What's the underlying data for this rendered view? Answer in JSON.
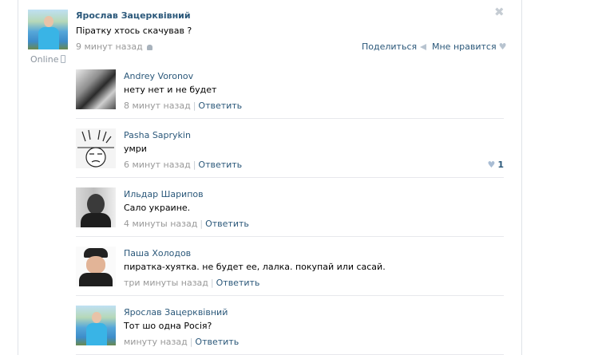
{
  "post": {
    "author": "Ярослав Зацерквівний",
    "text": "Піратку хтось скачував ?",
    "time": "9 минут назад",
    "presence": "Online",
    "share_label": "Поделиться",
    "like_label": "Мне нравится",
    "close": "✖"
  },
  "comments": [
    {
      "author": "Andrey Voronov",
      "text": "нету нет и не будет",
      "time": "8 минут назад",
      "reply": "Ответить",
      "sep": "|"
    },
    {
      "author": "Pasha Saprykin",
      "text": "умри",
      "time": "6 минут назад",
      "reply": "Ответить",
      "sep": "|",
      "likes": "1"
    },
    {
      "author": "Ильдар Шарипов",
      "text": "Сало украине.",
      "time": "4 минуты назад",
      "reply": "Ответить",
      "sep": "|"
    },
    {
      "author": "Паша Холодов",
      "text": "пиратка-хуятка. не будет ее, лалка. покупай или сасай.",
      "time": "три минуты назад",
      "reply": "Ответить",
      "sep": "|"
    },
    {
      "author": "Ярослав Зацерквівний",
      "text": "Тот шо одна Росія?",
      "time": "минуту назад",
      "reply": "Ответить",
      "sep": "|"
    }
  ],
  "icons": {
    "heart": "♥",
    "accent_color": "#2b587a"
  }
}
